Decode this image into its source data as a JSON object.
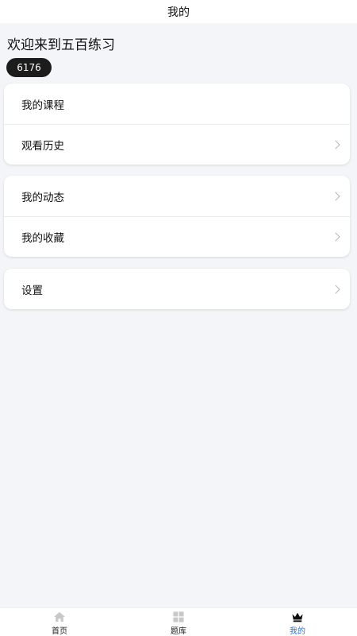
{
  "header": {
    "title": "我的"
  },
  "profile": {
    "welcome": "欢迎来到五百练习",
    "uid": "6176"
  },
  "groups": [
    {
      "items": [
        {
          "label": "我的课程",
          "chevron": false
        },
        {
          "label": "观看历史",
          "chevron": true
        }
      ]
    },
    {
      "items": [
        {
          "label": "我的动态",
          "chevron": true
        },
        {
          "label": "我的收藏",
          "chevron": true
        }
      ]
    },
    {
      "items": [
        {
          "label": "设置",
          "chevron": true
        }
      ]
    }
  ],
  "tabbar": {
    "tabs": [
      {
        "label": "首页",
        "icon": "home-icon",
        "active": false
      },
      {
        "label": "题库",
        "icon": "grid-icon",
        "active": false
      },
      {
        "label": "我的",
        "icon": "crown-icon",
        "active": true
      }
    ],
    "active_color": "#2f6fd1",
    "inactive_icon_color": "#c8c8c8"
  }
}
